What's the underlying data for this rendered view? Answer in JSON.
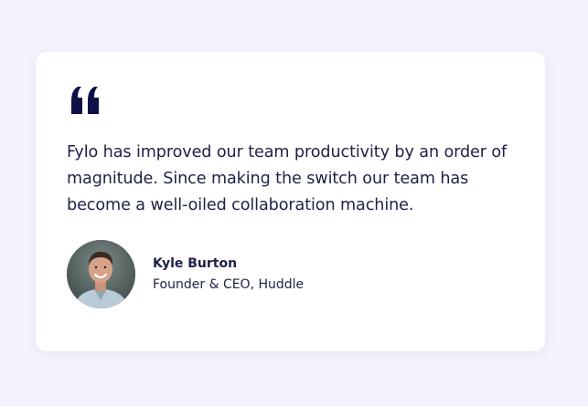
{
  "testimonial": {
    "quote": "Fylo has improved our team productivity by an order of magnitude. Since making the switch our team has become a well-oiled collaboration machine.",
    "author": {
      "name": "Kyle Burton",
      "title": "Founder & CEO, Huddle"
    },
    "icons": {
      "quote": "quote-icon",
      "avatar": "avatar-photo"
    }
  },
  "colors": {
    "background": "#f4f5fc",
    "card": "#ffffff",
    "text": "#1d2145",
    "quote_mark": "#0f1048"
  }
}
